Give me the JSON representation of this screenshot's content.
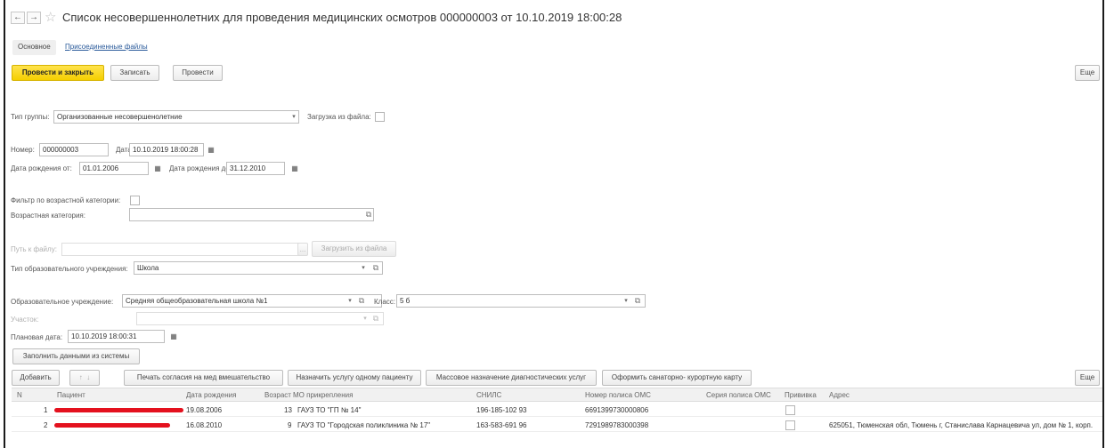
{
  "header": {
    "back_icon": "←",
    "forward_icon": "→",
    "star_icon": "☆",
    "title": "Список несовершеннолетних для проведения медицинских осмотров 000000003 от 10.10.2019 18:00:28"
  },
  "tabs": [
    "Основное",
    "Присоединенные файлы"
  ],
  "toolbar": {
    "post_close": "Провести и закрыть",
    "save": "Записать",
    "post": "Провести",
    "more": "Еще"
  },
  "form": {
    "group_type_label": "Тип группы:",
    "group_type_value": "Организованные несовершенолетние",
    "load_from_file_label": "Загрузка из файла:",
    "number_label": "Номер:",
    "number_value": "000000003",
    "date_label": "Дата:",
    "date_value": "10.10.2019 18:00:28",
    "birth_from_label": "Дата рождения от:",
    "birth_from_value": "01.01.2006",
    "birth_to_label": "Дата рождения до:",
    "birth_to_value": "31.12.2010",
    "age_filter_label": "Фильтр по возрастной категории:",
    "age_category_label": "Возрастная категория:",
    "age_category_value": "",
    "file_path_label": "Путь к файлу:",
    "file_path_value": "",
    "load_button": "Загрузить из файла",
    "ellipsis": "...",
    "edu_type_label": "Тип образовательного учреждения:",
    "edu_type_value": "Школа",
    "edu_label": "Образовательное учреждение:",
    "edu_value": "Средняя общеобразовательная школа №1",
    "class_label": "Класс:",
    "class_value": "5 б",
    "site_label": "Участок:",
    "site_value": "",
    "planned_date_label": "Плановая дата:",
    "planned_date_value": "10.10.2019 18:00:31",
    "fill_button": "Заполнить данными из системы"
  },
  "table_toolbar": {
    "add": "Добавить",
    "up_icon": "↑",
    "down_icon": "↓",
    "print_consent": "Печать согласия на мед вмешательство",
    "assign_one": "Назначить услугу одному пациенту",
    "mass_assign": "Массовое назначение диагностических услуг",
    "sanatorium": "Оформить санаторно- курортную карту",
    "more": "Еще"
  },
  "table": {
    "headers": [
      "N",
      "Пациент",
      "Дата рождения",
      "Возраст",
      "МО прикрепления",
      "СНИЛС",
      "Номер полиса ОМС",
      "Серия полиса ОМС",
      "Прививка",
      "Адрес"
    ],
    "rows": [
      {
        "n": "1",
        "birth": "19.08.2006",
        "age": "13",
        "mo": "ГАУЗ ТО \"ГП № 14\"",
        "snils": "196-185-102 93",
        "policy": "6691399730000806",
        "series": "",
        "address": ""
      },
      {
        "n": "2",
        "birth": "16.08.2010",
        "age": "9",
        "mo": "ГАУЗ ТО \"Городская поликлиника № 17\"",
        "snils": "163-583-691 96",
        "policy": "7291989783000398",
        "series": "",
        "address": "625051, Тюменская обл, Тюмень г, Станислава Карнацевича ул, дом № 1, корп."
      }
    ]
  },
  "icons": {
    "calendar": "▦",
    "dropdown": "▾",
    "open": "⧉"
  },
  "colors": {
    "primary_button": "#f5cf00",
    "link": "#2a5a9a",
    "redaction": "#e4111e"
  }
}
